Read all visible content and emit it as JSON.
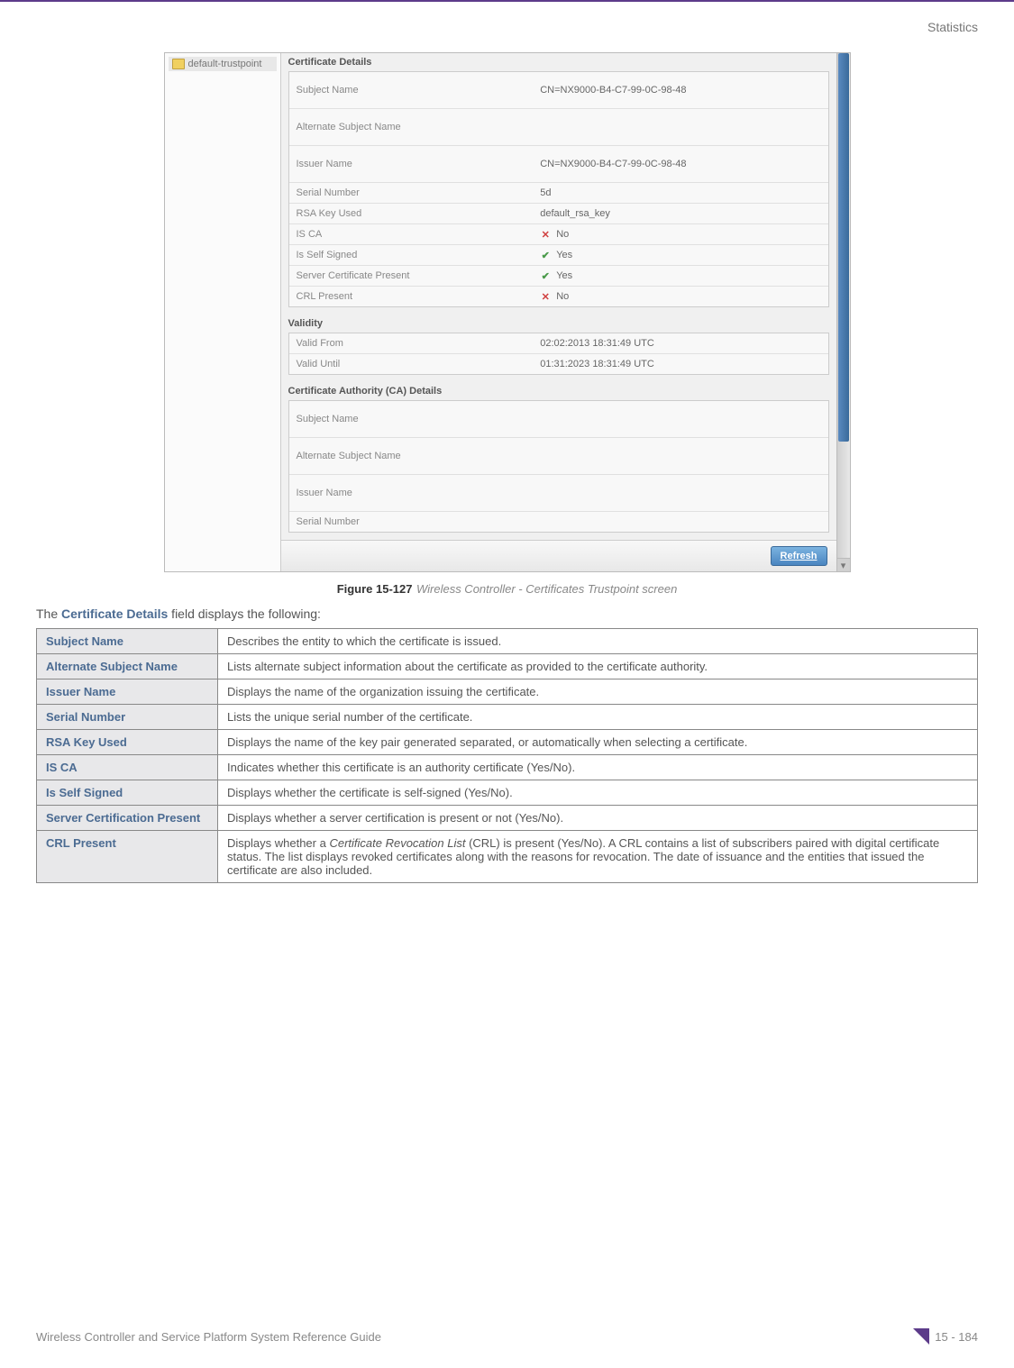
{
  "header": {
    "section": "Statistics"
  },
  "screenshot": {
    "sidebar": {
      "item": "default-trustpoint"
    },
    "sections": {
      "cert_details_title": "Certificate Details",
      "validity_title": "Validity",
      "ca_details_title": "Certificate Authority (CA) Details"
    },
    "cert": {
      "subject_name_label": "Subject Name",
      "subject_name_value": "CN=NX9000-B4-C7-99-0C-98-48",
      "alt_subject_label": "Alternate Subject Name",
      "alt_subject_value": "",
      "issuer_label": "Issuer Name",
      "issuer_value": "CN=NX9000-B4-C7-99-0C-98-48",
      "serial_label": "Serial Number",
      "serial_value": "5d",
      "rsa_label": "RSA Key Used",
      "rsa_value": "default_rsa_key",
      "isca_label": "IS CA",
      "isca_value": "No",
      "selfsigned_label": "Is Self Signed",
      "selfsigned_value": "Yes",
      "servercert_label": "Server Certificate Present",
      "servercert_value": "Yes",
      "crl_label": "CRL Present",
      "crl_value": "No"
    },
    "validity": {
      "from_label": "Valid From",
      "from_value": "02:02:2013 18:31:49 UTC",
      "until_label": "Valid Until",
      "until_value": "01:31:2023 18:31:49 UTC"
    },
    "ca": {
      "subject_name_label": "Subject Name",
      "alt_subject_label": "Alternate Subject Name",
      "issuer_label": "Issuer Name",
      "serial_label": "Serial Number"
    },
    "refresh_label": "Refresh"
  },
  "figure": {
    "label": "Figure 15-127",
    "desc": "Wireless Controller - Certificates Trustpoint screen"
  },
  "intro": {
    "prefix": "The ",
    "bold": "Certificate Details",
    "suffix": " field displays the following:"
  },
  "table": {
    "rows": [
      {
        "label": "Subject Name",
        "desc": "Describes the entity to which the certificate is issued."
      },
      {
        "label": "Alternate Subject Name",
        "desc": "Lists alternate subject information about the certificate as provided to the certificate authority."
      },
      {
        "label": "Issuer Name",
        "desc": "Displays the name of the organization issuing the certificate."
      },
      {
        "label": "Serial Number",
        "desc": "Lists the unique serial number of the certificate."
      },
      {
        "label": "RSA Key Used",
        "desc": "Displays the name of the key pair generated separated, or automatically when selecting a certificate."
      },
      {
        "label": "IS CA",
        "desc": "Indicates whether this certificate is an authority certificate (Yes/No)."
      },
      {
        "label": "Is Self Signed",
        "desc": "Displays whether the certificate is self-signed (Yes/No)."
      },
      {
        "label": "Server Certification Present",
        "desc": "Displays whether a server certification is present or not (Yes/No)."
      },
      {
        "label": "CRL Present",
        "desc_pre": "Displays whether a ",
        "desc_italic": "Certificate Revocation List",
        "desc_post": " (CRL) is present (Yes/No). A CRL contains a list of subscribers paired with digital certificate status. The list displays revoked certificates along with the reasons for revocation. The date of issuance and the entities that issued the certificate are also included."
      }
    ]
  },
  "footer": {
    "guide": "Wireless Controller and Service Platform System Reference Guide",
    "page": "15 - 184"
  }
}
